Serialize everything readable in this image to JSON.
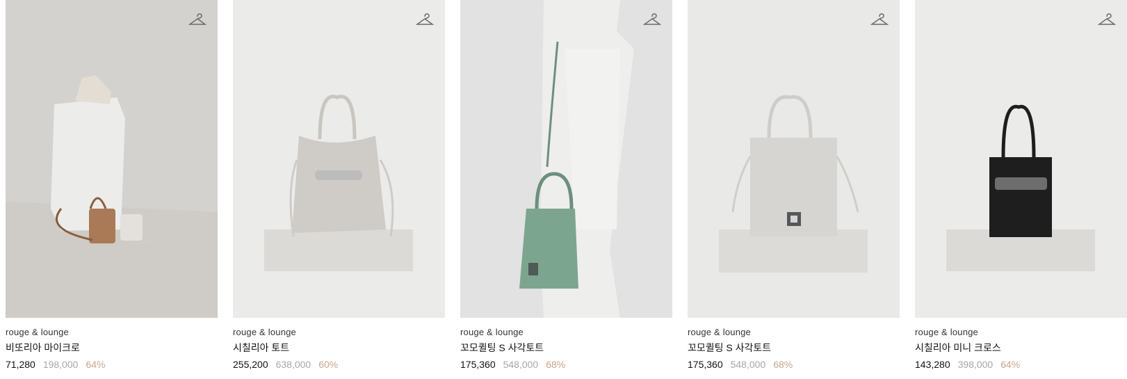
{
  "products": [
    {
      "brand": "rouge & lounge",
      "name": "비또리아 마이크로",
      "price": "71,280",
      "original_price": "198,000",
      "discount": "64%",
      "bg": "#d8d7d3",
      "icon": "hanger-icon"
    },
    {
      "brand": "rouge & lounge",
      "name": "시칠리아 토트",
      "price": "255,200",
      "original_price": "638,000",
      "discount": "60%",
      "bg": "#ebebea",
      "icon": "hanger-icon"
    },
    {
      "brand": "rouge & lounge",
      "name": "꼬모퀼팅 S 사각토트",
      "price": "175,360",
      "original_price": "548,000",
      "discount": "68%",
      "bg": "#e1e2e1",
      "icon": "hanger-icon"
    },
    {
      "brand": "rouge & lounge",
      "name": "꼬모퀼팅 S 사각토트",
      "price": "175,360",
      "original_price": "548,000",
      "discount": "68%",
      "bg": "#e9e9e7",
      "icon": "hanger-icon"
    },
    {
      "brand": "rouge & lounge",
      "name": "시칠리아 미니 크로스",
      "price": "143,280",
      "original_price": "398,000",
      "discount": "64%",
      "bg": "#ebebea",
      "icon": "hanger-icon"
    }
  ],
  "colors": {
    "price": "#111111",
    "original_price": "#a7a7a7",
    "discount": "#c9a58a"
  }
}
